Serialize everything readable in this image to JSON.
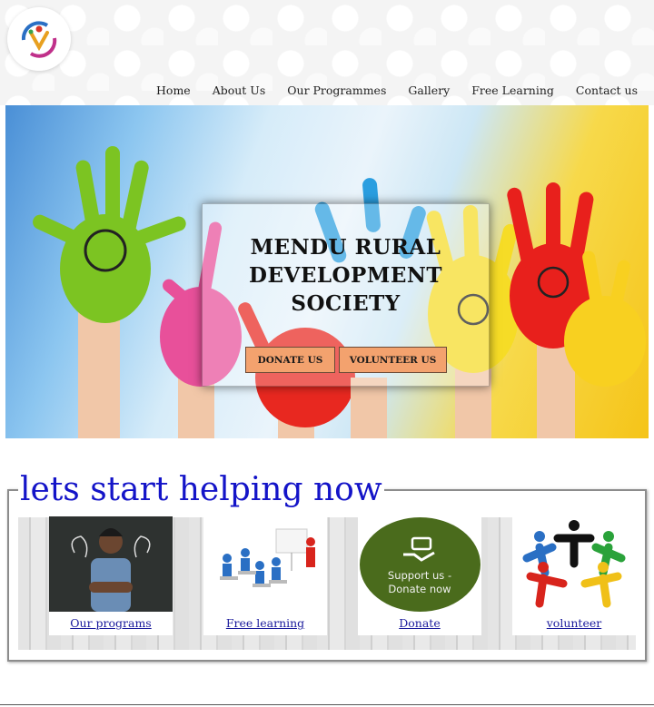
{
  "nav": {
    "items": [
      "Home",
      "About Us",
      "Our Programmes",
      "Gallery",
      "Free Learning",
      "Contact us"
    ]
  },
  "hero": {
    "title_lines": [
      "MENDU RURAL",
      "DEVELOPMENT",
      "SOCIETY"
    ],
    "donate_label": "DONATE US",
    "volunteer_label": "VOLUNTEER US"
  },
  "help": {
    "heading": "lets start helping now",
    "cards": [
      {
        "label": "Our programs"
      },
      {
        "label": "Free learning"
      },
      {
        "label": "Donate",
        "image_text": [
          "Support us -",
          "Donate now"
        ]
      },
      {
        "label": "volunteer"
      }
    ]
  },
  "colors": {
    "heading": "#1414c8",
    "button": "#f3a26e",
    "donate_circle": "#4a6b1c",
    "link": "#1a1a9c"
  }
}
